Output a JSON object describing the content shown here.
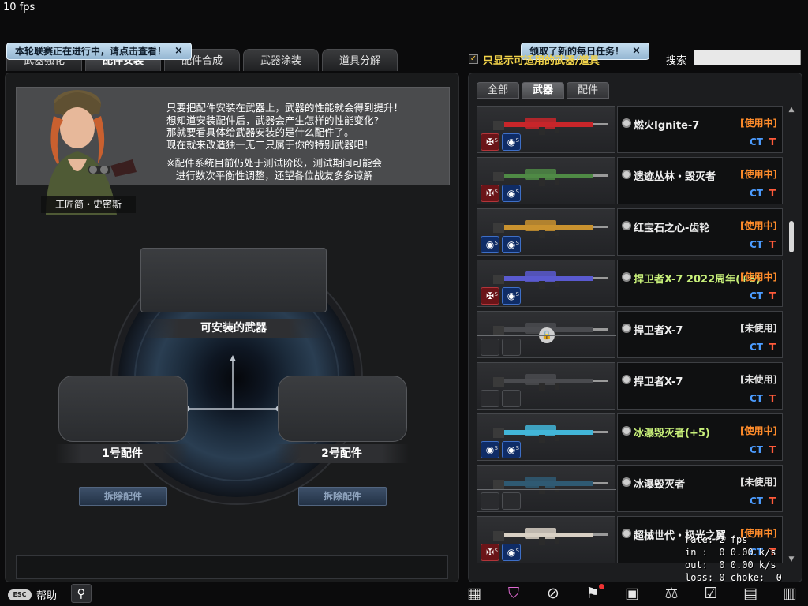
{
  "hud": {
    "fps": "10 fps"
  },
  "banners": {
    "league": {
      "text": "本轮联赛正在进行中，请点击查看！",
      "close": "×"
    },
    "daily": {
      "text": "领取了新的每日任务！",
      "close": "×"
    }
  },
  "tabs": [
    "武器强化",
    "配件安装",
    "配件合成",
    "武器涂装",
    "道具分解"
  ],
  "npc": {
    "name": "工匠简・史密斯",
    "dialog": "只要把配件安装在武器上，武器的性能就会得到提升！\n想知道安装配件后，武器会产生怎样的性能变化?\n那就要看具体给武器安装的是什么配件了。\n现在就来改造独一无二只属于你的特别武器吧！",
    "note": "※配件系统目前仍处于测试阶段，测试期间可能会\n   进行数次平衡性调整，还望各位战友多多谅解"
  },
  "install": {
    "weapon_label": "可安装的武器",
    "slot1_label": "1号配件",
    "slot2_label": "2号配件",
    "remove_label": "拆除配件"
  },
  "filter": {
    "checked": true,
    "check_glyph": "✓",
    "label": "只显示可适用的武器/道具",
    "search_label": "搜索",
    "search_value": ""
  },
  "subtabs": [
    "全部",
    "武器",
    "配件"
  ],
  "items": [
    {
      "name": "燃火Ignite-7",
      "status": "[使用中]",
      "status_type": "inuse",
      "locked": false,
      "green": false,
      "accent": "#c8262a",
      "badges": [
        "red",
        "blue"
      ]
    },
    {
      "name": "遗迹丛林・毁灭者",
      "status": "[使用中]",
      "status_type": "inuse",
      "locked": false,
      "green": false,
      "accent": "#4f8a45",
      "badges": [
        "red",
        "blue"
      ]
    },
    {
      "name": "红宝石之心-齿轮",
      "status": "[使用中]",
      "status_type": "inuse",
      "locked": false,
      "green": false,
      "accent": "#c9922f",
      "badges": [
        "blue",
        "blue"
      ]
    },
    {
      "name": "捍卫者X-7 2022周年(+5)",
      "status": "[使用中]",
      "status_type": "inuse",
      "locked": false,
      "green": true,
      "accent": "#5a5ad0",
      "badges": [
        "red",
        "blue"
      ]
    },
    {
      "name": "捍卫者X-7",
      "status": "[未使用]",
      "status_type": "unused",
      "locked": true,
      "green": false,
      "accent": "#4a4b4f",
      "badges": [
        "empty",
        "empty"
      ]
    },
    {
      "name": "捍卫者X-7",
      "status": "[未使用]",
      "status_type": "unused",
      "locked": false,
      "green": false,
      "accent": "#4a4b4f",
      "badges": [
        "empty",
        "empty"
      ]
    },
    {
      "name": "冰瀑毁灭者(+5)",
      "status": "[使用中]",
      "status_type": "inuse",
      "locked": false,
      "green": true,
      "accent": "#42b6d8",
      "badges": [
        "blue",
        "blue"
      ]
    },
    {
      "name": "冰瀑毁灭者",
      "status": "[未使用]",
      "status_type": "unused",
      "locked": false,
      "green": false,
      "accent": "#2f5a73",
      "badges": [
        "empty",
        "empty"
      ]
    },
    {
      "name": "超械世代・极光之翼",
      "status": "[使用中]",
      "status_type": "inuse",
      "locked": false,
      "green": false,
      "accent": "#d8d0c4",
      "badges": [
        "red",
        "blue"
      ]
    }
  ],
  "team_labels": {
    "ct": "CT",
    "t": "T"
  },
  "netstats": "rate: 2 fps\nin :  0 0.00 k/s\nout:  0 0.00 k/s\nloss: 0 choke:  0",
  "bottom": {
    "help_pill": "ESC",
    "help_label": "帮助",
    "search_icon": "magnifier-icon"
  },
  "taskbar_icons": [
    {
      "name": "calendar-grid-icon",
      "glyph": "▦"
    },
    {
      "name": "shop-basket-icon",
      "glyph": "⛉"
    },
    {
      "name": "compass-icon",
      "glyph": "⊘"
    },
    {
      "name": "runner-icon",
      "glyph": "⚑"
    },
    {
      "name": "market-icon",
      "glyph": "▣"
    },
    {
      "name": "scales-icon",
      "glyph": "⚖"
    },
    {
      "name": "tasks-icon",
      "glyph": "☑"
    },
    {
      "name": "calendar-check-icon",
      "glyph": "▤"
    },
    {
      "name": "film-icon",
      "glyph": "▥"
    }
  ]
}
